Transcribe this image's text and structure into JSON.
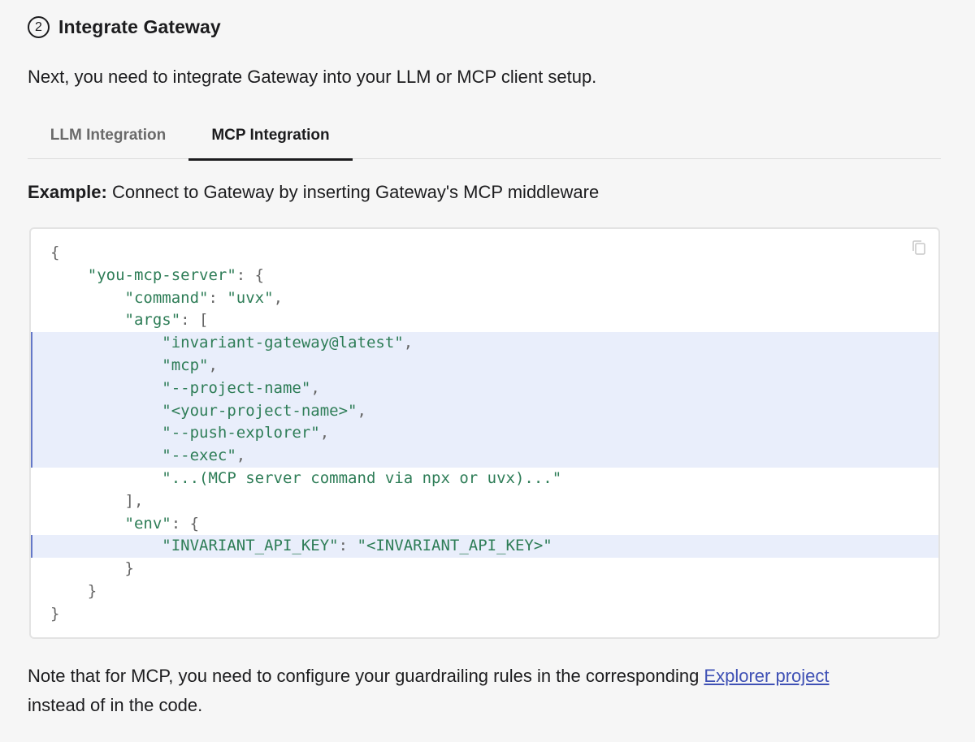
{
  "step": {
    "number": "2",
    "title": "Integrate Gateway"
  },
  "intro_text": "Next, you need to integrate Gateway into your LLM or MCP client setup.",
  "tabs": [
    {
      "label": "LLM Integration",
      "active": false
    },
    {
      "label": "MCP Integration",
      "active": true
    }
  ],
  "example": {
    "label": "Example:",
    "text": " Connect to Gateway by inserting Gateway's MCP middleware"
  },
  "code": {
    "copy_icon": "copy-icon",
    "highlight_color": "#e9eefb",
    "lines": [
      {
        "indent": "",
        "parts": [
          [
            "pun",
            "{"
          ]
        ],
        "hl": false
      },
      {
        "indent": "    ",
        "parts": [
          [
            "str",
            "\"you-mcp-server\""
          ],
          [
            "pun",
            ": {"
          ]
        ],
        "hl": false
      },
      {
        "indent": "        ",
        "parts": [
          [
            "str",
            "\"command\""
          ],
          [
            "pun",
            ": "
          ],
          [
            "str",
            "\"uvx\""
          ],
          [
            "pun",
            ","
          ]
        ],
        "hl": false
      },
      {
        "indent": "        ",
        "parts": [
          [
            "str",
            "\"args\""
          ],
          [
            "pun",
            ": ["
          ]
        ],
        "hl": false
      },
      {
        "indent": "            ",
        "parts": [
          [
            "str",
            "\"invariant-gateway@latest\""
          ],
          [
            "pun",
            ","
          ]
        ],
        "hl": true
      },
      {
        "indent": "            ",
        "parts": [
          [
            "str",
            "\"mcp\""
          ],
          [
            "pun",
            ","
          ]
        ],
        "hl": true
      },
      {
        "indent": "            ",
        "parts": [
          [
            "str",
            "\"--project-name\""
          ],
          [
            "pun",
            ","
          ]
        ],
        "hl": true
      },
      {
        "indent": "            ",
        "parts": [
          [
            "str",
            "\"<your-project-name>\""
          ],
          [
            "pun",
            ","
          ]
        ],
        "hl": true
      },
      {
        "indent": "            ",
        "parts": [
          [
            "str",
            "\"--push-explorer\""
          ],
          [
            "pun",
            ","
          ]
        ],
        "hl": true
      },
      {
        "indent": "            ",
        "parts": [
          [
            "str",
            "\"--exec\""
          ],
          [
            "pun",
            ","
          ]
        ],
        "hl": true
      },
      {
        "indent": "            ",
        "parts": [
          [
            "str",
            "\"...(MCP server command via npx or uvx)...\""
          ]
        ],
        "hl": false
      },
      {
        "indent": "        ",
        "parts": [
          [
            "pun",
            "],"
          ]
        ],
        "hl": false
      },
      {
        "indent": "        ",
        "parts": [
          [
            "str",
            "\"env\""
          ],
          [
            "pun",
            ": {"
          ]
        ],
        "hl": false
      },
      {
        "indent": "            ",
        "parts": [
          [
            "str",
            "\"INVARIANT_API_KEY\""
          ],
          [
            "pun",
            ": "
          ],
          [
            "str",
            "\"<INVARIANT_API_KEY>\""
          ]
        ],
        "hl": true
      },
      {
        "indent": "        ",
        "parts": [
          [
            "pun",
            "}"
          ]
        ],
        "hl": false
      },
      {
        "indent": "    ",
        "parts": [
          [
            "pun",
            "}"
          ]
        ],
        "hl": false
      },
      {
        "indent": "",
        "parts": [
          [
            "pun",
            "}"
          ]
        ],
        "hl": false
      }
    ]
  },
  "note": {
    "before": "Note that for MCP, you need to configure your guardrailing rules in the corresponding ",
    "link": "Explorer project",
    "after": " instead of in the code."
  }
}
